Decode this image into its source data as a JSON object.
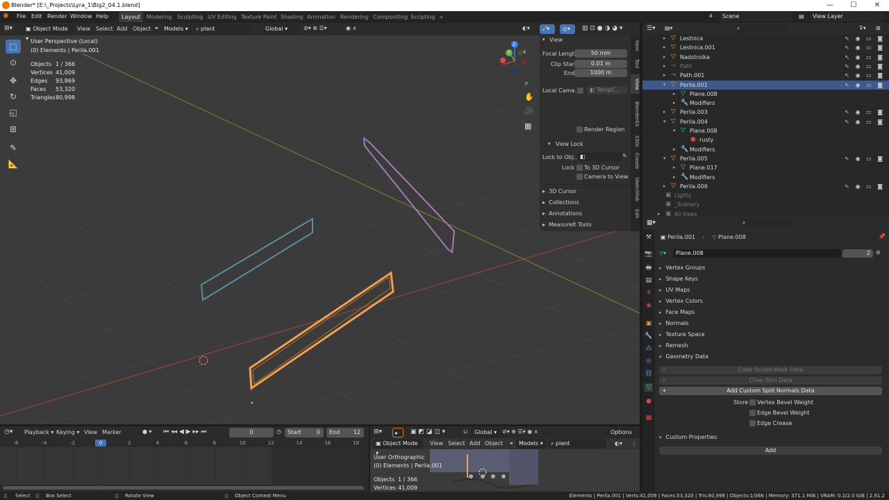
{
  "window": {
    "title": "Blender* [E:\\_Projects\\Lyra_1\\Big2_04.1.blend]",
    "min": "—",
    "max": "☐",
    "close": "✕"
  },
  "menu": [
    "File",
    "Edit",
    "Render",
    "Window",
    "Help"
  ],
  "workspaces": [
    "Layout",
    "Modeling",
    "Sculpting",
    "UV Editing",
    "Texture Paint",
    "Shading",
    "Animation",
    "Rendering",
    "Compositing",
    "Scripting"
  ],
  "scene": {
    "scene_name": "Scene",
    "view_layer": "View Layer"
  },
  "viewport": {
    "mode": "Object Mode",
    "menus": [
      "View",
      "Select",
      "Add",
      "Object"
    ],
    "collection_filter": "Models",
    "search_value": "plant",
    "transform_orientation": "Global",
    "info_line1": "User Perspective (Local)",
    "info_line2": "(0) Elements | Perila.001",
    "stats": [
      {
        "label": "Objects",
        "value": "1 / 366"
      },
      {
        "label": "Vertices",
        "value": "41,009"
      },
      {
        "label": "Edges",
        "value": "93,869"
      },
      {
        "label": "Faces",
        "value": "53,320"
      },
      {
        "label": "Triangles",
        "value": "80,998"
      }
    ],
    "gizmo": {
      "x": "X",
      "y": "Y",
      "z": "Z"
    }
  },
  "npanel": {
    "header": "View",
    "focal_length_label": "Focal Length",
    "focal_length": "50 mm",
    "clip_start_label": "Clip Start",
    "clip_start": "0.01 m",
    "end_label": "End",
    "end": "1000 m",
    "local_camera_label": "Local Came...",
    "local_camera_value": "TempC...",
    "render_region": "Render Region",
    "view_lock": "View Lock",
    "lock_to_obj_label": "Lock to Obj...",
    "lock_label": "Lock",
    "to_3d_cursor": "To 3D Cursor",
    "camera_to_view": "Camera to View",
    "sections": [
      "3D Cursor",
      "Collections",
      "Annotations",
      "MeasureIt Tools"
    ],
    "tabs": [
      "Item",
      "Tool",
      "View",
      "BlenderKit",
      "SSGI",
      "Create",
      "Sketchfab",
      "Edit"
    ]
  },
  "outliner": {
    "rows": [
      {
        "name": "Lestnica",
        "indent": 0,
        "tri": "▸",
        "icon": "▽",
        "color": "#e39a4a",
        "vis": true
      },
      {
        "name": "Lestnica.001",
        "indent": 0,
        "tri": "▸",
        "icon": "▽",
        "color": "#e39a4a",
        "vis": true
      },
      {
        "name": "Nadstroika",
        "indent": 0,
        "tri": "▸",
        "icon": "▽",
        "color": "#e39a4a",
        "vis": true
      },
      {
        "name": "Path",
        "indent": 0,
        "tri": "▸",
        "icon": "⤳",
        "color": "#777",
        "vis": true,
        "dim": true
      },
      {
        "name": "Path.001",
        "indent": 0,
        "tri": "▸",
        "icon": "⤳",
        "color": "#e39a4a",
        "vis": true
      },
      {
        "name": "Perila.001",
        "indent": 0,
        "tri": "▾",
        "icon": "▽",
        "color": "#e39a4a",
        "vis": true,
        "sel": true
      },
      {
        "name": "Plane.008",
        "indent": 1,
        "tri": "▸",
        "icon": "▽",
        "color": "#3ecfa0",
        "vis": false
      },
      {
        "name": "Modifiers",
        "indent": 1,
        "tri": "▸",
        "icon": "🔧",
        "color": "#7aa0e0",
        "vis": false
      },
      {
        "name": "Perila.003",
        "indent": 0,
        "tri": "▸",
        "icon": "▽",
        "color": "#e39a4a",
        "vis": true
      },
      {
        "name": "Perila.004",
        "indent": 0,
        "tri": "▾",
        "icon": "▽",
        "color": "#e39a4a",
        "vis": true
      },
      {
        "name": "Plane.008",
        "indent": 1,
        "tri": "▾",
        "icon": "▽",
        "color": "#3ecfa0",
        "vis": false
      },
      {
        "name": "rusty",
        "indent": 2,
        "tri": "",
        "icon": "●",
        "color": "#d04848",
        "vis": false
      },
      {
        "name": "Modifiers",
        "indent": 1,
        "tri": "▸",
        "icon": "🔧",
        "color": "#7aa0e0",
        "vis": false
      },
      {
        "name": "Perila.005",
        "indent": 0,
        "tri": "▾",
        "icon": "▽",
        "color": "#e39a4a",
        "vis": true
      },
      {
        "name": "Plane.017",
        "indent": 1,
        "tri": "▸",
        "icon": "▽",
        "color": "#3ecfa0",
        "vis": false
      },
      {
        "name": "Modifiers",
        "indent": 1,
        "tri": "▸",
        "icon": "🔧",
        "color": "#7aa0e0",
        "vis": false
      },
      {
        "name": "Perila.006",
        "indent": 0,
        "tri": "▸",
        "icon": "▽",
        "color": "#e39a4a",
        "vis": true
      },
      {
        "name": "Lights",
        "indent": -1,
        "tri": "",
        "icon": "▣",
        "color": "#777",
        "vis": false,
        "dim": true
      },
      {
        "name": "_Scenery",
        "indent": -1,
        "tri": "",
        "icon": "▣",
        "color": "#777",
        "vis": false,
        "dim": true
      },
      {
        "name": "All trees",
        "indent": -1,
        "tri": "▸",
        "icon": "▣",
        "color": "#777",
        "vis": false,
        "dim": true
      }
    ]
  },
  "properties": {
    "breadcrumb_object": "Perila.001",
    "breadcrumb_mesh": "Plane.008",
    "mesh_name": "Plane.008",
    "users": "2",
    "sections": [
      "Vertex Groups",
      "Shape Keys",
      "UV Maps",
      "Vertex Colors",
      "Face Maps",
      "Normals",
      "Texture Space",
      "Remesh"
    ],
    "geometry_data": "Geometry Data",
    "clear_sculpt": "Clear Sculpt-Mask Data",
    "clear_skin": "Clear Skin Data",
    "add_split_normals": "Add Custom Split Normals Data",
    "store_label": "Store",
    "vertex_bevel": "Vertex Bevel Weight",
    "edge_bevel": "Edge Bevel Weight",
    "edge_crease": "Edge Crease",
    "custom_props": "Custom Properties",
    "add_btn": "Add"
  },
  "timeline": {
    "menus": [
      "Playback",
      "Keying",
      "View",
      "Marker"
    ],
    "current_frame": "0",
    "start_label": "Start",
    "start": "0",
    "end_label": "End",
    "end": "12",
    "ticks": [
      "-6",
      "-4",
      "-2",
      "0",
      "2",
      "4",
      "6",
      "8",
      "10",
      "12",
      "14",
      "16",
      "18"
    ]
  },
  "mini_viewport": {
    "transform": "Global",
    "options": "Options",
    "mode": "Object Mode",
    "menus": [
      "View",
      "Select",
      "Add",
      "Object"
    ],
    "collection": "Models",
    "search": "plant",
    "info_line1": "User Orthographic",
    "info_line2": "(0) Elements | Perila.001",
    "objects_label": "Objects",
    "objects": "1 / 366",
    "vertices_label": "Vertices",
    "vertices": "41,009"
  },
  "statusbar": {
    "select": "Select",
    "box_select": "Box Select",
    "rotate_view": "Rotate View",
    "context_menu": "Object Context Menu",
    "info": "Elements | Perila.001 | Verts:41,009 | Faces:53,320 | Tris:80,998 | Objects:1/366 | Memory: 371.1 MiB | VRAM: 0.2/2.0 GiB | 2.91.2"
  }
}
